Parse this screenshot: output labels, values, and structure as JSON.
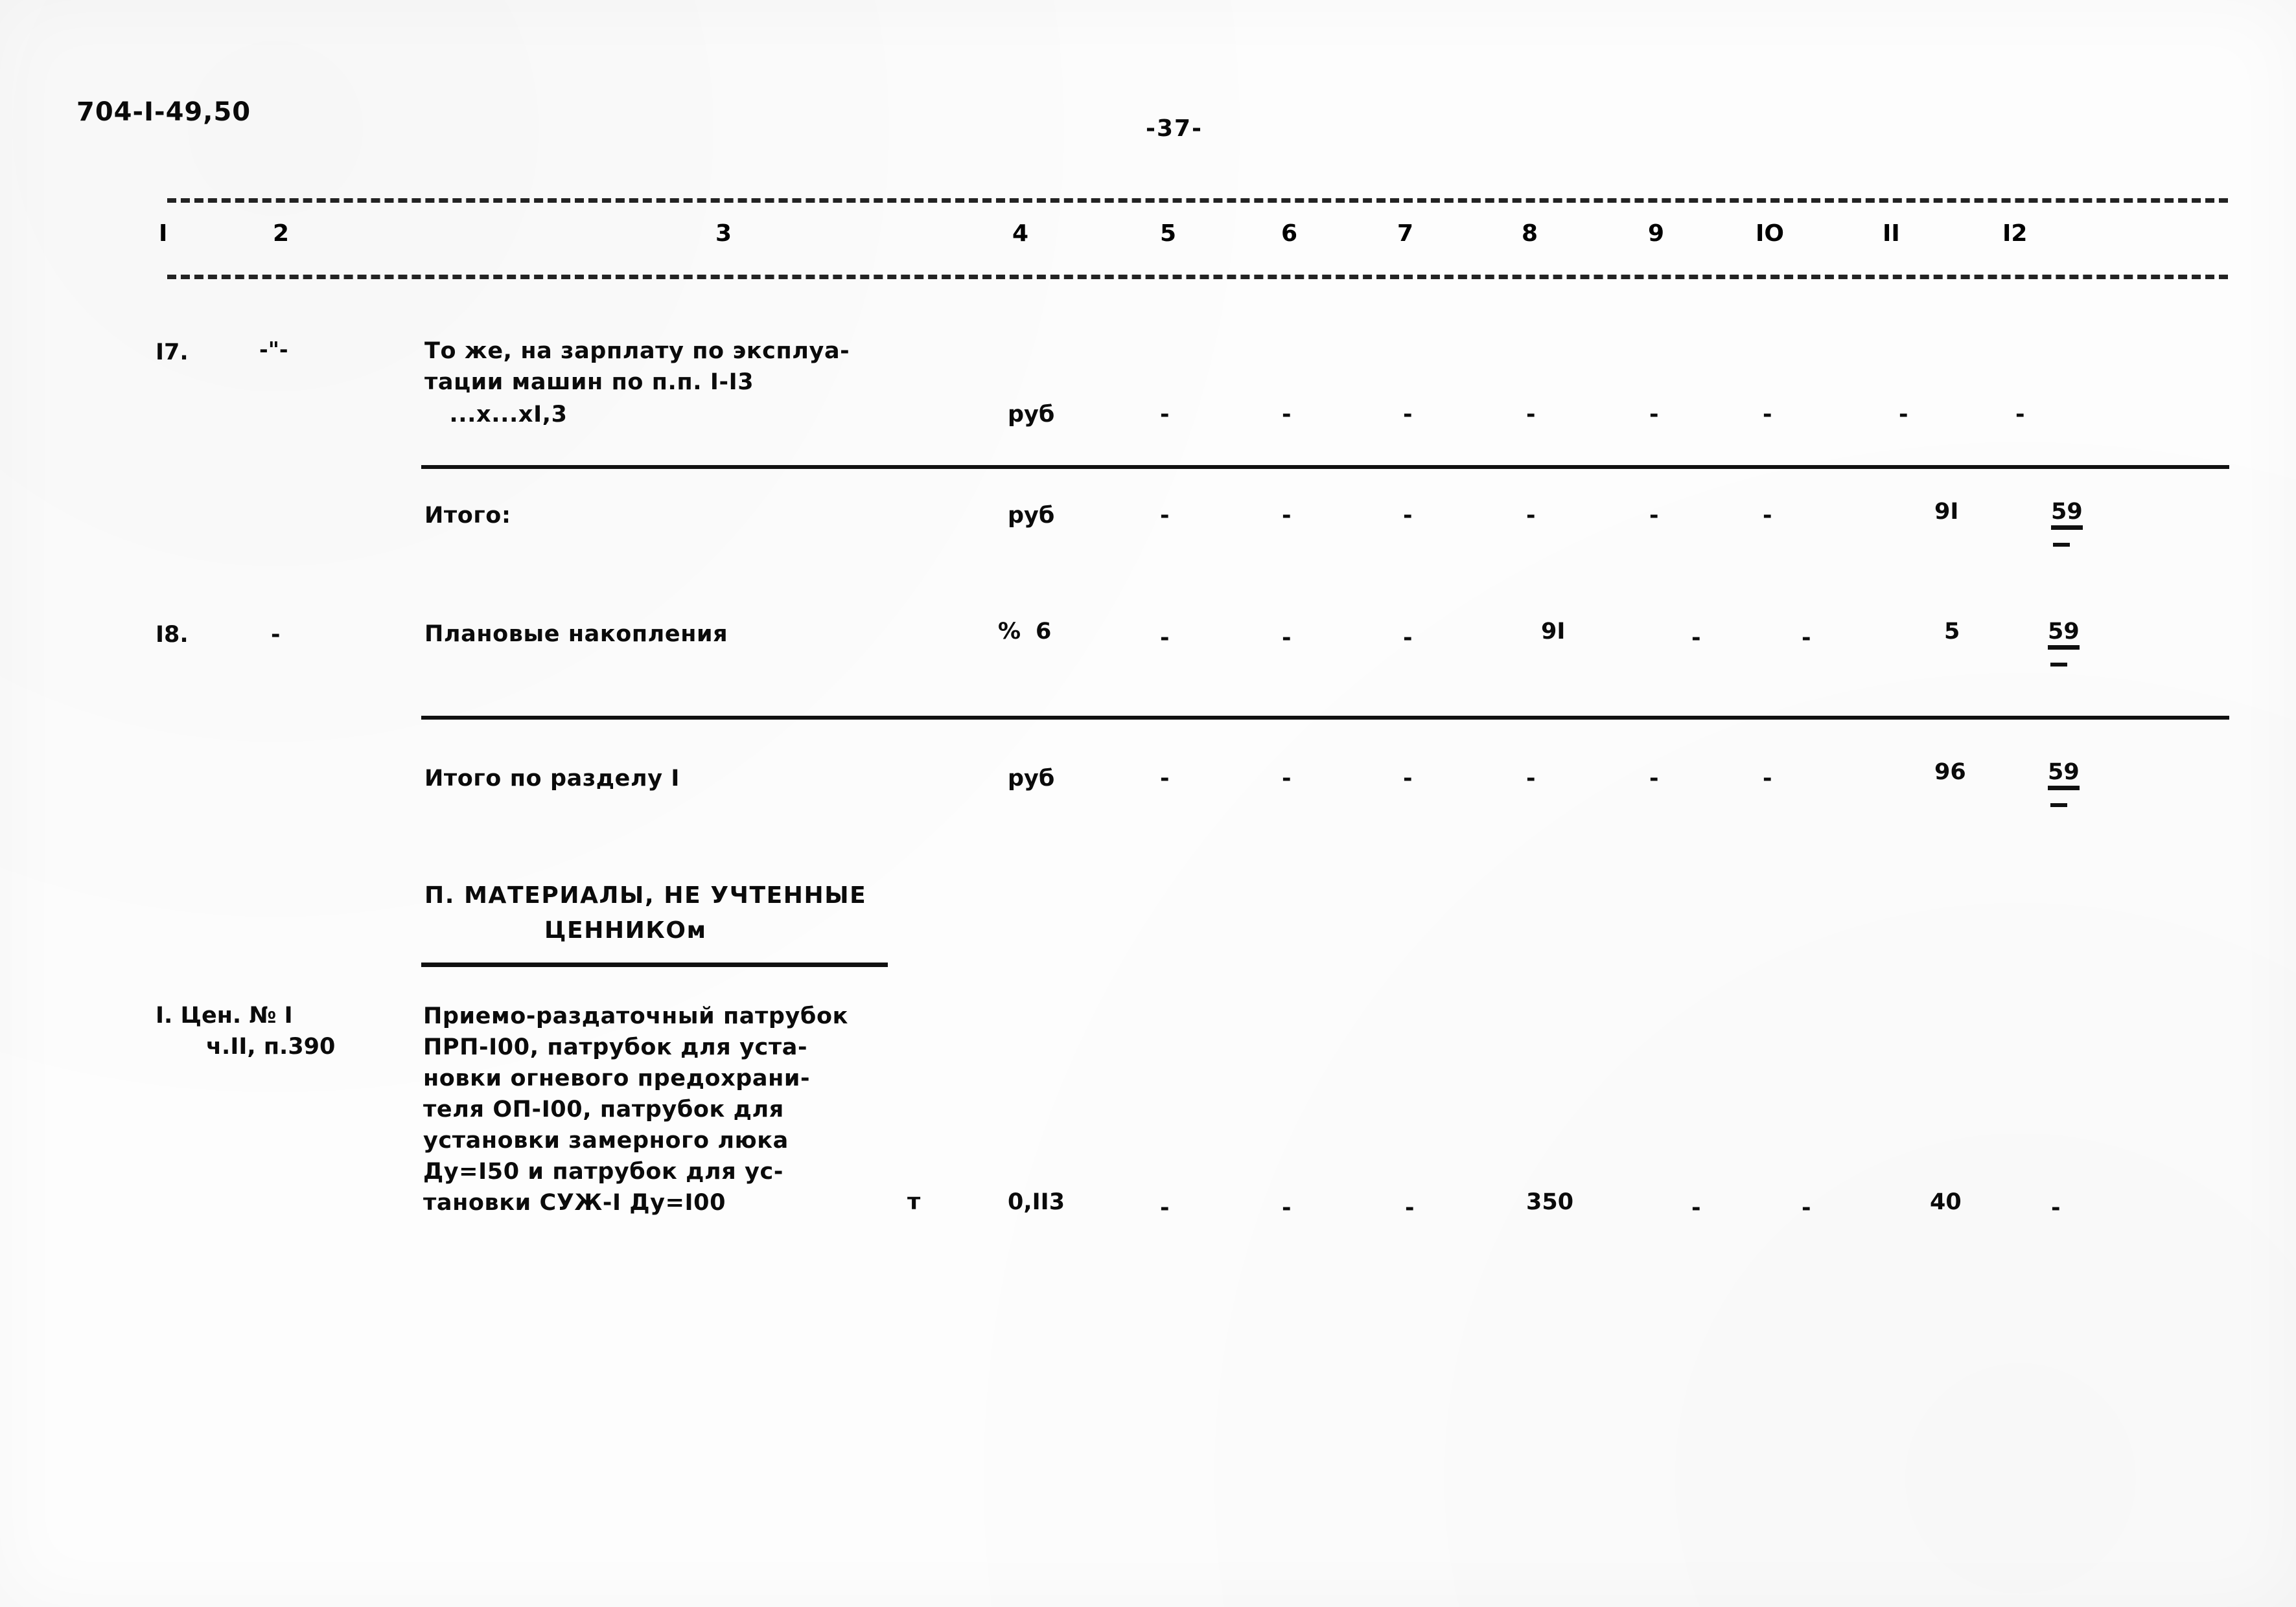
{
  "document": {
    "code": "704-I-49,50",
    "page_number": "-37-"
  },
  "table": {
    "column_numbers": [
      "I",
      "2",
      "3",
      "4",
      "5",
      "6",
      "7",
      "8",
      "9",
      "IO",
      "II",
      "I2"
    ],
    "rows": [
      {
        "id": "row-17",
        "no": "I7.",
        "ref": "-\"-",
        "description_lines": [
          "То же, на зарплату по эксплуа-",
          "тации машин по п.п. I-I3",
          "   ...х...хI,3"
        ],
        "unit": "руб",
        "c4": "-",
        "c5": "-",
        "c6": "-",
        "c7": "-",
        "c8": "-",
        "c9": "-",
        "c10": "-",
        "c11": "-",
        "c12": "-"
      },
      {
        "id": "row-itogo",
        "no": "",
        "ref": "",
        "description_lines": [
          "Итого:"
        ],
        "unit": "руб",
        "c4": "-",
        "c5": "-",
        "c6": "-",
        "c7": "-",
        "c8": "-",
        "c9": "-",
        "c10": "-",
        "c11": "9I",
        "c12": "59"
      },
      {
        "id": "row-18",
        "no": "I8.",
        "ref": "-",
        "description_lines": [
          "Плановые накопления"
        ],
        "unit": "%",
        "c4": "6",
        "c5": "-",
        "c6": "-",
        "c7": "-",
        "c8": "9I",
        "c9": "-",
        "c10": "-",
        "c11": "5",
        "c12": "59"
      },
      {
        "id": "row-itogo-razdel",
        "no": "",
        "ref": "",
        "description_lines": [
          "Итого по разделу I"
        ],
        "unit": "руб",
        "c4": "-",
        "c5": "-",
        "c6": "-",
        "c7": "-",
        "c8": "-",
        "c9": "-",
        "c10": "-",
        "c11": "96",
        "c12": "59"
      },
      {
        "id": "row-material-1",
        "no": "I. Цен. № I",
        "ref": "ч.II, п.390",
        "description_lines": [
          "Приемо-раздаточный патрубок",
          "ПРП-I00, патрубок для уста-",
          "новки огневого предохрани-",
          "теля ОП-I00, патрубок для",
          "установки замерного люка",
          "Ду=I50 и патрубок для ус-",
          "тановки СУЖ-I Ду=I00"
        ],
        "unit": "т",
        "c4": "0,II3",
        "c5": "-",
        "c6": "-",
        "c7": "-",
        "c8": "350",
        "c9": "-",
        "c10": "-",
        "c11": "40",
        "c12": "-"
      }
    ]
  },
  "section_heading": {
    "line1": "П. МАТЕРИАЛЫ, НЕ УЧТЕННЫЕ",
    "line2": "ЦЕННИКОм"
  }
}
